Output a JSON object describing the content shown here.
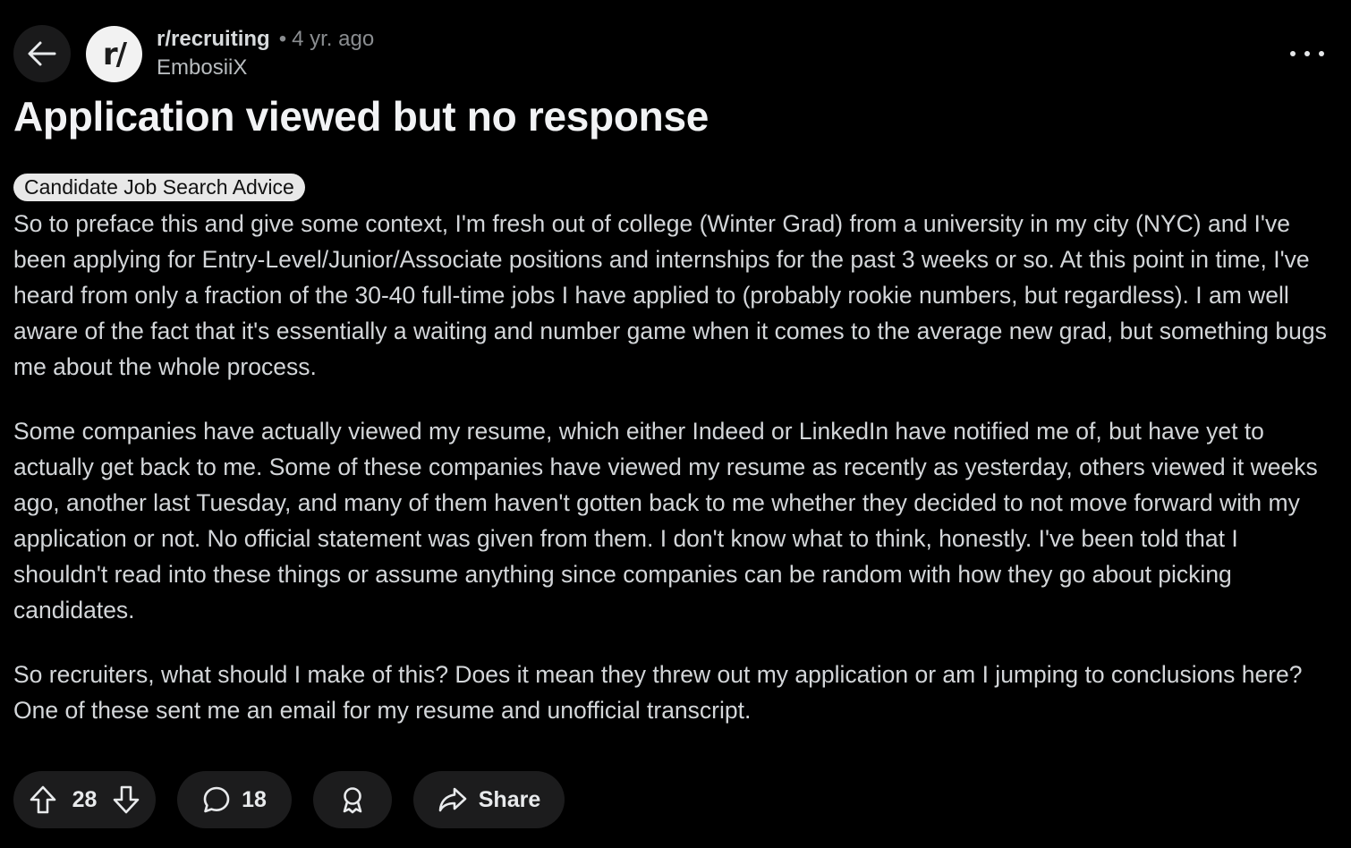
{
  "header": {
    "subreddit": "r/recruiting",
    "subreddit_icon_text": "r/",
    "separator": "•",
    "age": "4 yr. ago",
    "author": "EmbosiiX"
  },
  "post": {
    "title": "Application viewed but no response",
    "flair": "Candidate Job Search Advice",
    "paragraphs": [
      "So to preface this and give some context, I'm fresh out of college (Winter Grad) from a university in my city (NYC) and I've been applying for Entry-Level/Junior/Associate positions and internships for the past 3 weeks or so. At this point in time, I've heard from only a fraction of the 30-40 full-time jobs I have applied to (probably rookie numbers, but regardless). I am well aware of the fact that it's essentially a waiting and number game when it comes to the average new grad, but something bugs me about the whole process.",
      "Some companies have actually viewed my resume, which either Indeed or LinkedIn have notified me of, but have yet to actually get back to me. Some of these companies have viewed my resume as recently as yesterday, others viewed it weeks ago, another last Tuesday, and many of them haven't gotten back to me whether they decided to not move forward with my application or not. No official statement was given from them. I don't know what to think, honestly. I've been told that I shouldn't read into these things or assume anything since companies can be random with how they go about picking candidates.",
      "So recruiters, what should I make of this? Does it mean they threw out my application or am I jumping to conclusions here? One of these sent me an email for my resume and unofficial transcript."
    ]
  },
  "actions": {
    "votes": "28",
    "comments": "18",
    "share_label": "Share"
  },
  "icons": {
    "back": "arrow-left-icon",
    "more": "ellipsis-icon",
    "upvote": "arrow-up-icon",
    "downvote": "arrow-down-icon",
    "comment": "speech-bubble-icon",
    "award": "award-ribbon-icon",
    "share": "share-arrow-icon"
  },
  "colors": {
    "background": "#000000",
    "pill_background": "#1c1c1d",
    "flair_background": "#e8e8e8",
    "text": "#d3d6d9",
    "muted": "#8a8d90"
  }
}
